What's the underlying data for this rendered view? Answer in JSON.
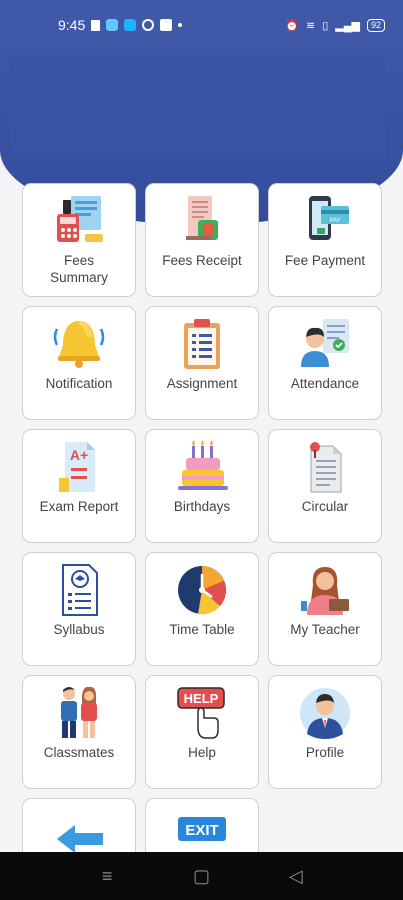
{
  "status_bar": {
    "time": "9:45",
    "battery": "92",
    "icons": [
      "download-icon",
      "app-icon",
      "mail-icon",
      "circle-icon",
      "card-icon",
      "dot-icon",
      "alarm-icon",
      "wifi-icon",
      "vibrate-icon",
      "signal-icon",
      "battery-icon"
    ]
  },
  "colors": {
    "header": "#3d56a6",
    "tile_border": "#cfcfd3",
    "label": "#444444"
  },
  "menu": [
    {
      "label": "Fees\nSummary",
      "icon": "fees-summary-icon"
    },
    {
      "label": "Fees Receipt",
      "icon": "fees-receipt-icon"
    },
    {
      "label": "Fee Payment",
      "icon": "fee-payment-icon"
    },
    {
      "label": "Notification",
      "icon": "bell-icon"
    },
    {
      "label": "Assignment",
      "icon": "clipboard-icon"
    },
    {
      "label": "Attendance",
      "icon": "attendance-icon"
    },
    {
      "label": "Exam Report",
      "icon": "exam-report-icon"
    },
    {
      "label": "Birthdays",
      "icon": "cake-icon"
    },
    {
      "label": "Circular",
      "icon": "circular-icon"
    },
    {
      "label": "Syllabus",
      "icon": "syllabus-icon"
    },
    {
      "label": "Time Table",
      "icon": "clock-icon"
    },
    {
      "label": "My Teacher",
      "icon": "teacher-icon"
    },
    {
      "label": "Classmates",
      "icon": "classmates-icon"
    },
    {
      "label": "Help",
      "icon": "help-icon"
    },
    {
      "label": "Profile",
      "icon": "profile-icon"
    },
    {
      "label": "",
      "icon": "back-arrow-icon"
    },
    {
      "label": "",
      "icon": "exit-icon"
    }
  ],
  "exit_sign_text": "EXIT",
  "help_sign_text": "HELP",
  "nav": {
    "recent": "recent-apps-icon",
    "home": "home-icon",
    "back": "back-icon"
  }
}
